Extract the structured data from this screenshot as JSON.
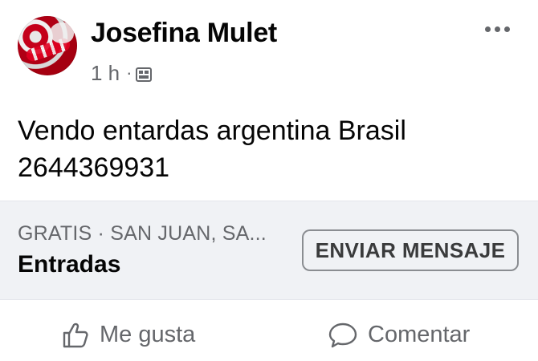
{
  "post": {
    "author": "Josefina Mulet",
    "time": "1 h",
    "separator": "·",
    "audience_icon": "marketplace-icon",
    "more_icon": "more-options-icon",
    "text_lines": [
      "Vendo entardas argentina Brasil",
      "2644369931"
    ]
  },
  "listing": {
    "meta": "GRATIS · SAN JUAN, SA...",
    "title": "Entradas",
    "button_label": "ENVIAR MENSAJE"
  },
  "actions": {
    "like_label": "Me gusta",
    "comment_label": "Comentar"
  },
  "colors": {
    "secondary_text": "#65676b",
    "listing_background": "#f0f2f5"
  }
}
